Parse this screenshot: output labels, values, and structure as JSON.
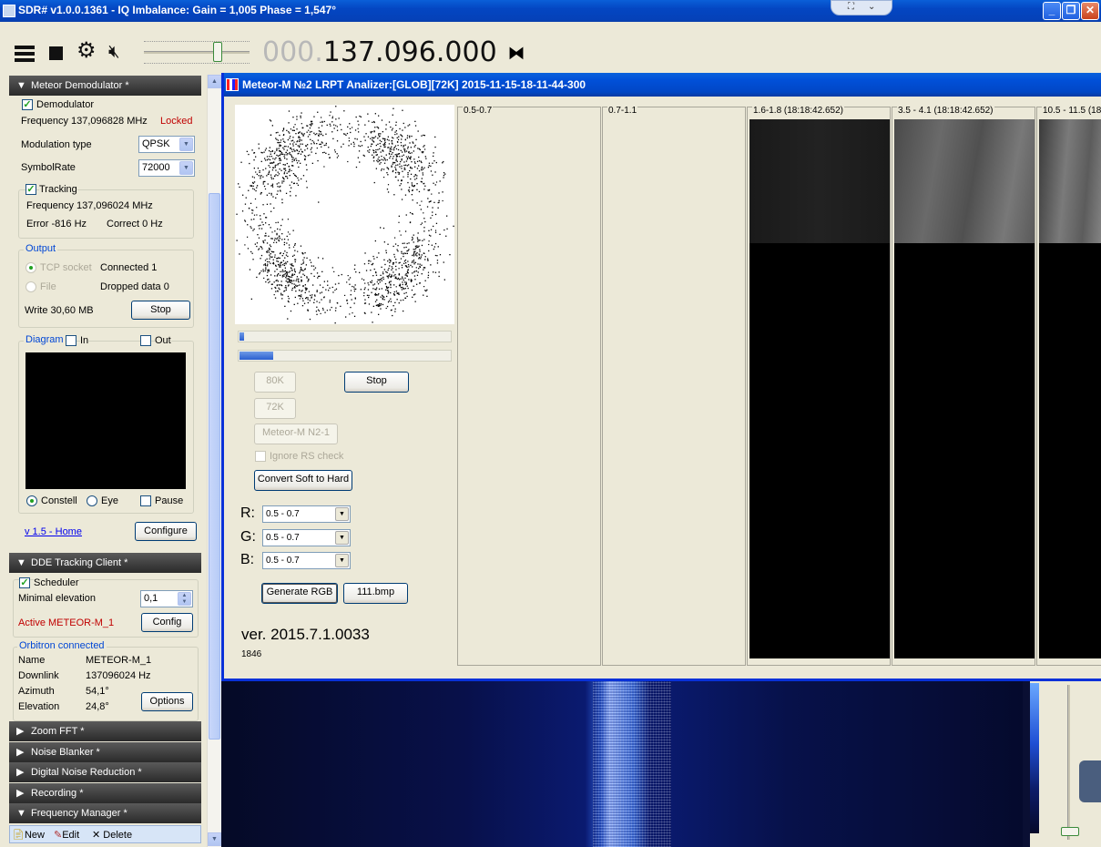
{
  "titlebar": {
    "title": "SDR# v1.0.0.1361 - IQ Imbalance: Gain = 1,005 Phase = 1,547°"
  },
  "toolbar": {
    "freq_dim": "000.",
    "freq_bright": "137.096.000"
  },
  "meteor_demod": {
    "header": "Meteor Demodulator *",
    "demodulator_label": "Demodulator",
    "demodulator_checked": true,
    "frequency": "Frequency 137,096828 MHz",
    "status": "Locked",
    "modulation_label": "Modulation type",
    "modulation_value": "QPSK",
    "symbolrate_label": "SymbolRate",
    "symbolrate_value": "72000",
    "tracking_label": "Tracking",
    "tracking_checked": true,
    "tracking_frequency": "Frequency 137,096024 MHz",
    "error": "Error -816 Hz",
    "correct": "Correct 0 Hz",
    "output_title": "Output",
    "tcp_label": "TCP socket",
    "connected": "Connected 1",
    "file_label": "File",
    "dropped": "Dropped data 0",
    "write": "Write 30,60 MB",
    "stop_label": "Stop",
    "diagram_title": "Diagram",
    "in_label": "In",
    "out_label": "Out",
    "constell_label": "Constell",
    "eye_label": "Eye",
    "pause_label": "Pause",
    "home_link": "v 1.5 - Home",
    "configure_label": "Configure"
  },
  "dde": {
    "header": "DDE Tracking Client *",
    "scheduler_label": "Scheduler",
    "scheduler_checked": true,
    "min_elev_label": "Minimal elevation",
    "min_elev_value": "0,1",
    "active": "Active METEOR-M_1",
    "config_label": "Config",
    "orbitron_title": "Orbitron connected",
    "name_label": "Name",
    "name_value": "METEOR-M_1",
    "downlink_label": "Downlink",
    "downlink_value": "137096024 Hz",
    "azimuth_label": "Azimuth",
    "azimuth_value": "54,1°",
    "elevation_label": "Elevation",
    "elevation_value": "24,8°",
    "options_label": "Options"
  },
  "sections": {
    "zoom_fft": "Zoom FFT *",
    "noise_blanker": "Noise Blanker *",
    "dnr": "Digital Noise Reduction *",
    "recording": "Recording *",
    "freq_manager": "Frequency Manager *"
  },
  "freq_manager_toolbar": {
    "new": "New",
    "edit": "Edit",
    "delete": "Delete"
  },
  "analyzer": {
    "title": "Meteor-M №2 LRPT Analizer:[GLOB][72K] 2015-11-15-18-11-44-300",
    "btn_80k": "80K",
    "btn_stop": "Stop",
    "btn_72k": "72K",
    "btn_meteor": "Meteor-M N2-1",
    "ignore_rs": "Ignore RS check",
    "convert_btn": "Convert Soft to Hard",
    "r_label": "R:",
    "g_label": "G:",
    "b_label": "B:",
    "r_value": "0.5 - 0.7",
    "g_value": "0.5 - 0.7",
    "b_value": "0.5 - 0.7",
    "generate_btn": "Generate RGB",
    "bmp_btn": "111.bmp",
    "version": "ver. 2015.7.1.0033",
    "count": "1846",
    "progress1": 0.02,
    "progress2": 0.16,
    "bands": [
      {
        "label": "0.5-0.7"
      },
      {
        "label": "0.7-1.1"
      },
      {
        "label": "1.6-1.8 (18:18:42.652)"
      },
      {
        "label": "3.5 - 4.1 (18:18:42.652)"
      },
      {
        "label": "10.5 - 11.5 (18"
      }
    ]
  }
}
